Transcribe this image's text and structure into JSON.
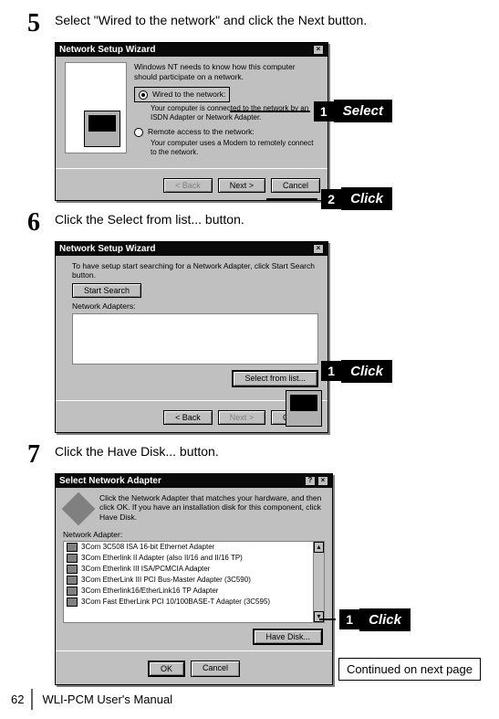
{
  "steps": {
    "s5": {
      "num": "5",
      "text": "Select \"Wired to the network\" and click the Next button."
    },
    "s6": {
      "num": "6",
      "text": "Click the Select from list... button."
    },
    "s7": {
      "num": "7",
      "text": "Click the Have Disk... button."
    }
  },
  "shot1": {
    "title": "Network Setup Wizard",
    "intro": "Windows NT needs to know how this computer should participate on a network.",
    "opt1_label": "Wired to the network:",
    "opt1_desc": "Your computer is connected to the network by an ISDN Adapter or Network Adapter.",
    "opt2_label": "Remote access to the network:",
    "opt2_desc": "Your computer uses a Modem to remotely connect to the network.",
    "back": "< Back",
    "next": "Next >",
    "cancel": "Cancel"
  },
  "shot2": {
    "title": "Network Setup Wizard",
    "intro": "To have setup start searching for a Network Adapter, click Start Search button.",
    "search": "Start Search",
    "list_label": "Network Adapters:",
    "select_from_list": "Select from list...",
    "back": "< Back",
    "next": "Next >",
    "cancel": "Cancel"
  },
  "shot3": {
    "title": "Select Network Adapter",
    "intro": "Click the Network Adapter that matches your hardware, and then click OK. If you have an installation disk for this component, click Have Disk.",
    "list_label": "Network Adapter:",
    "items": [
      "3Com 3C508 ISA 16-bit Ethernet Adapter",
      "3Com Etherlink II Adapter (also II/16 and II/16 TP)",
      "3Com Etherlink III ISA/PCMCIA Adapter",
      "3Com EtherLink III PCI Bus-Master Adapter (3C590)",
      "3Com Etherlink16/EtherLink16 TP Adapter",
      "3Com Fast EtherLink PCI 10/100BASE-T Adapter (3C595)"
    ],
    "have_disk": "Have Disk...",
    "ok": "OK",
    "cancel": "Cancel"
  },
  "callouts": {
    "select": "Select",
    "click": "Click"
  },
  "footer": {
    "continued": "Continued on next page",
    "page": "62",
    "manual": "WLI-PCM User's Manual"
  }
}
